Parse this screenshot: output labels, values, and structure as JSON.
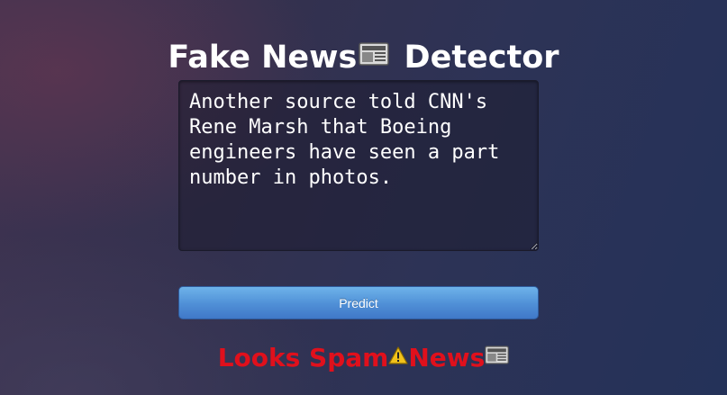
{
  "header": {
    "title_part1": "Fake News",
    "title_icon": "newspaper-icon",
    "title_part2": " Detector"
  },
  "form": {
    "news_text": "Another source told CNN's Rene Marsh that Boeing engineers have seen a part number in photos.",
    "predict_label": "Predict"
  },
  "result": {
    "text_part1": "Looks Spam",
    "warning_icon": "warning-icon",
    "text_part2": "News",
    "news_icon": "newspaper-icon",
    "color": "#e0101c"
  },
  "colors": {
    "button": "#4f8fd6",
    "title_text": "#ffffff"
  }
}
